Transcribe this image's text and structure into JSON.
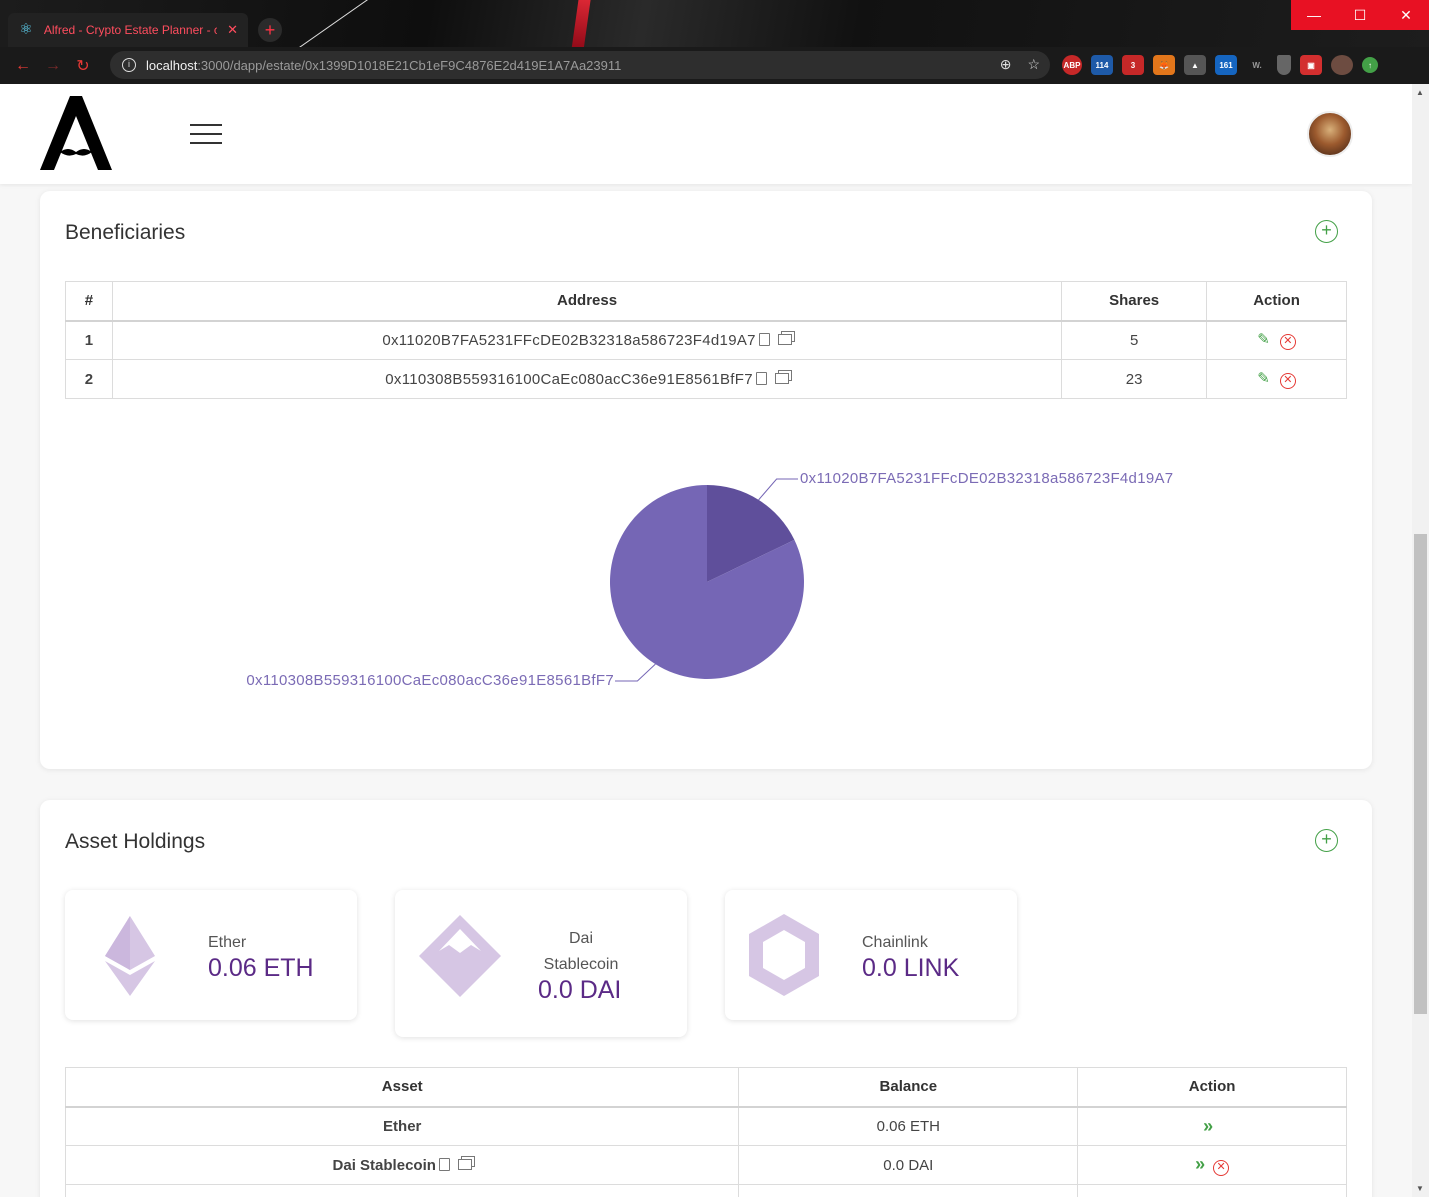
{
  "browser": {
    "tab_title": "Alfred - Crypto Estate Planner - c",
    "url_host": "localhost",
    "url_path": ":3000/dapp/estate/0x1399D1018E21Cb1eF9C4876E2d419E1A7Aa23911",
    "ext_badges": [
      "ABP",
      "114",
      "3",
      "161",
      "W."
    ]
  },
  "beneficiaries": {
    "title": "Beneficiaries",
    "columns": [
      "#",
      "Address",
      "Shares",
      "Action"
    ],
    "rows": [
      {
        "index": "1",
        "address": "0x11020B7FA5231FFcDE02B32318a586723F4d19A7",
        "shares": "5"
      },
      {
        "index": "2",
        "address": "0x110308B559316100CaEc080acC36e91E8561BfF7",
        "shares": "23"
      }
    ]
  },
  "chart_data": {
    "type": "pie",
    "labels": [
      "0x11020B7FA5231FFcDE02B32318a586723F4d19A7",
      "0x110308B559316100CaEc080acC36e91E8561BfF7"
    ],
    "values": [
      5,
      23
    ],
    "colors": [
      "#5f4f9b",
      "#7566b5"
    ]
  },
  "assets": {
    "title": "Asset Holdings",
    "tiles": [
      {
        "name": "Ether",
        "amount": "0.06 ETH"
      },
      {
        "name_line1": "Dai",
        "name_line2": "Stablecoin",
        "amount": "0.0 DAI"
      },
      {
        "name": "Chainlink",
        "amount": "0.0 LINK"
      }
    ],
    "columns": [
      "Asset",
      "Balance",
      "Action"
    ],
    "rows": [
      {
        "asset": "Ether",
        "balance": "0.06 ETH"
      },
      {
        "asset": "Dai Stablecoin",
        "balance": "0.0 DAI"
      }
    ]
  },
  "colors": {
    "accent_green": "#43a047",
    "danger_red": "#e53935",
    "brand_purple": "#5b2a86",
    "token_lilac": "#d6c6e4"
  }
}
